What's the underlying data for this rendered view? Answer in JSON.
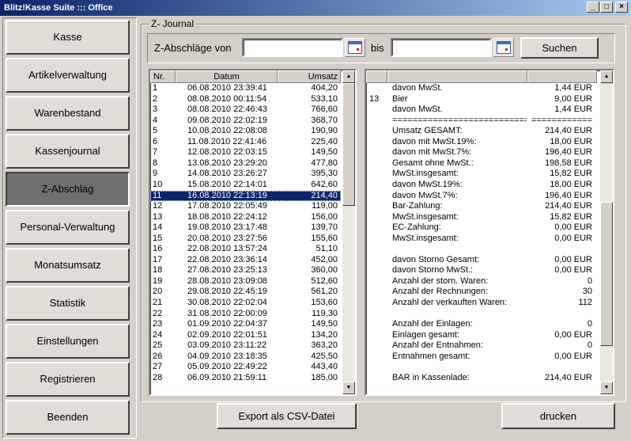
{
  "window": {
    "title": "Blitz!Kasse Suite ::: Office",
    "minimize": "_",
    "maximize": "□",
    "close": "×"
  },
  "sidebar": {
    "items": [
      {
        "label": "Kasse"
      },
      {
        "label": "Artikelverwaltung"
      },
      {
        "label": "Warenbestand"
      },
      {
        "label": "Kassenjournal"
      },
      {
        "label": "Z-Abschlag",
        "active": true
      },
      {
        "label": "Personal-Verwaltung"
      },
      {
        "label": "Monatsumsatz"
      },
      {
        "label": "Statistik"
      },
      {
        "label": "Einstellungen"
      },
      {
        "label": "Registrieren"
      },
      {
        "label": "Beenden"
      }
    ]
  },
  "journal": {
    "group_title": "Z- Journal",
    "filter": {
      "from_label": "Z-Abschläge von",
      "from_value": "",
      "to_label": "bis",
      "to_value": "",
      "search_label": "Suchen"
    },
    "left_table": {
      "columns": [
        "Nr.",
        "Datum",
        "Umsatz"
      ],
      "selected_index": 10,
      "rows": [
        [
          "1",
          "06.08.2010 23:39:41",
          "404,20"
        ],
        [
          "2",
          "08.08.2010 00:11:54",
          "533,10"
        ],
        [
          "3",
          "08.08.2010 22:46:43",
          "766,60"
        ],
        [
          "4",
          "09.08.2010 22:02:19",
          "368,70"
        ],
        [
          "5",
          "10.08.2010 22:08:08",
          "190,90"
        ],
        [
          "6",
          "11.08.2010 22:41:46",
          "225,40"
        ],
        [
          "7",
          "12.08.2010 22:03:15",
          "149,50"
        ],
        [
          "8",
          "13.08.2010 23:29:20",
          "477,80"
        ],
        [
          "9",
          "14.08.2010 23:26:27",
          "395,30"
        ],
        [
          "10",
          "15.08.2010 22:14:01",
          "642,60"
        ],
        [
          "11",
          "16.08.2010 22:13:19",
          "214,40"
        ],
        [
          "12",
          "17.08.2010 22:05:49",
          "119,00"
        ],
        [
          "13",
          "18.08.2010 22:24:12",
          "156,00"
        ],
        [
          "14",
          "19.08.2010 23:17:48",
          "139,70"
        ],
        [
          "15",
          "20.08.2010 23:27:56",
          "155,60"
        ],
        [
          "16",
          "22.08.2010 13:57:24",
          "51,10"
        ],
        [
          "17",
          "22.08.2010 23:36:14",
          "452,00"
        ],
        [
          "18",
          "27.08.2010 23:25:13",
          "360,00"
        ],
        [
          "19",
          "28.08.2010 23:09:08",
          "512,60"
        ],
        [
          "20",
          "29.08.2010 22:45:19",
          "561,20"
        ],
        [
          "21",
          "30.08.2010 22:02:04",
          "153,60"
        ],
        [
          "22",
          "31.08.2010 22:00:09",
          "119,30"
        ],
        [
          "23",
          "01.09.2010 22:04:37",
          "149,50"
        ],
        [
          "24",
          "02.09.2010 22:01:51",
          "134,20"
        ],
        [
          "25",
          "03.09.2010 23:11:22",
          "363,20"
        ],
        [
          "26",
          "04.09.2010 23:18:35",
          "425,50"
        ],
        [
          "27",
          "05.09.2010 22:49:22",
          "443,40"
        ],
        [
          "28",
          "06.09.2010 21:59:11",
          "185,00"
        ]
      ]
    },
    "right_table": {
      "rows": [
        [
          "",
          "davon MwSt.",
          "1,44 EUR"
        ],
        [
          "13",
          "Bier",
          "9,00 EUR"
        ],
        [
          "",
          "davon MwSt.",
          "1,44 EUR"
        ],
        [
          "",
          "===========================",
          "============"
        ],
        [
          "",
          "Umsatz GESAMT:",
          "214,40 EUR"
        ],
        [
          "",
          "davon mit MwSt.19%:",
          "18,00 EUR"
        ],
        [
          "",
          "davon mit MwSt.7%:",
          "196,40 EUR"
        ],
        [
          "",
          "Gesamt ohne MwSt.:",
          "198,58 EUR"
        ],
        [
          "",
          "MwSt.insgesamt:",
          "15,82 EUR"
        ],
        [
          "",
          "davon MwSt.19%:",
          "18,00 EUR"
        ],
        [
          "",
          "davon MwSt.7%:",
          "196,40 EUR"
        ],
        [
          "",
          "Bar-Zahlung:",
          "214,40 EUR"
        ],
        [
          "",
          "MwSt.insgesamt:",
          "15,82 EUR"
        ],
        [
          "",
          "EC-Zahlung:",
          "0,00 EUR"
        ],
        [
          "",
          "MwSt.insgesamt:",
          "0,00 EUR"
        ],
        [
          "",
          "",
          ""
        ],
        [
          "",
          "davon Storno Gesamt:",
          "0,00 EUR"
        ],
        [
          "",
          "davon Storno MwSt.:",
          "0,00 EUR"
        ],
        [
          "",
          "Anzahl der storn. Waren:",
          "0"
        ],
        [
          "",
          "Anzahl der Rechnungen:",
          "30"
        ],
        [
          "",
          "Anzahl der verkauften Waren:",
          "112"
        ],
        [
          "",
          "",
          ""
        ],
        [
          "",
          "Anzahl der Einlagen:",
          "0"
        ],
        [
          "",
          "Einlagen gesamt:",
          "0,00 EUR"
        ],
        [
          "",
          "Anzahl der Entnahmen:",
          "0"
        ],
        [
          "",
          "Entnahmen gesamt:",
          "0,00 EUR"
        ],
        [
          "",
          "",
          ""
        ],
        [
          "",
          "BAR in Kassenlade:",
          "214,40 EUR"
        ]
      ]
    },
    "export_label": "Export als CSV-Datei",
    "print_label": "drucken"
  },
  "scroll": {
    "up": "▲",
    "down": "▼"
  }
}
